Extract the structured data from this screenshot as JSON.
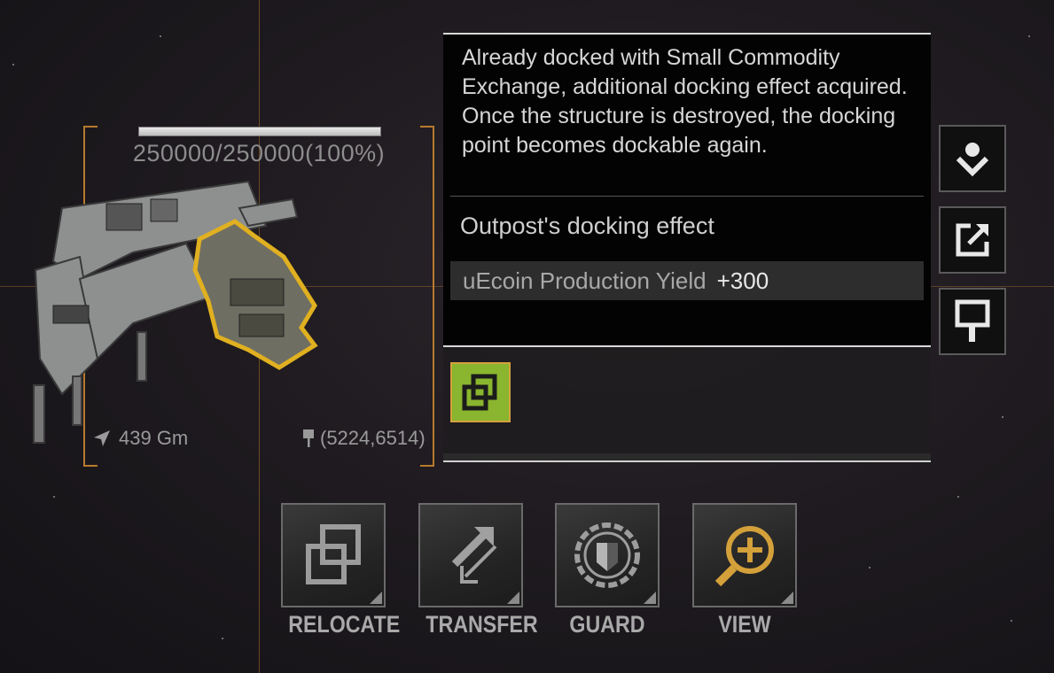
{
  "target": {
    "hp_fraction": 1.0,
    "hp_text": "250000/250000(100%)",
    "distance": "439 Gm",
    "coordinates": "(5224,6514)"
  },
  "panel": {
    "description": "Already docked with Small Commodity Exchange, additional docking effect acquired. Once the structure is destroyed, the docking point becomes dockable again.",
    "effect_title": "Outpost's docking effect",
    "effect": {
      "name": "uEcoin Production Yield",
      "value": "+300"
    },
    "dock_icon": "docking-link-icon"
  },
  "side_buttons": [
    {
      "icon": "dock-down-icon"
    },
    {
      "icon": "share-external-icon"
    },
    {
      "icon": "map-pin-icon"
    }
  ],
  "actions": [
    {
      "label": "RELOCATE",
      "icon": "relocate-icon"
    },
    {
      "label": "TRANSFER",
      "icon": "transfer-icon"
    },
    {
      "label": "GUARD",
      "icon": "guard-shield-icon"
    },
    {
      "label": "VIEW",
      "icon": "view-magnifier-icon"
    }
  ],
  "colors": {
    "bracket": "#b87a2e",
    "dock_icon_bg": "#8ab52e",
    "view_icon": "#d3a03a"
  }
}
